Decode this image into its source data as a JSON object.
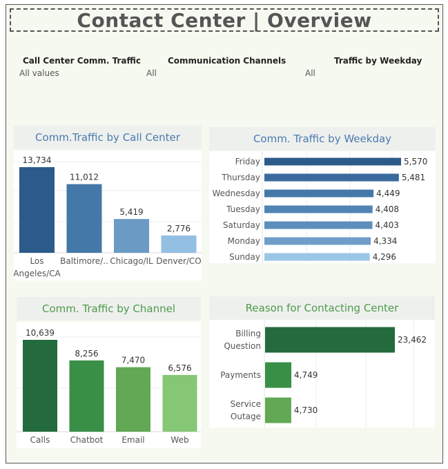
{
  "title": "Contact Center | Overview",
  "filters": [
    {
      "label": "Call Center Comm. Traffic",
      "value": "All values",
      "value2": "All"
    },
    {
      "label": "Communication Channels",
      "value": "All"
    },
    {
      "label": "Traffic by Weekday",
      "value": "All"
    }
  ],
  "colors": {
    "blue_dark": "#2c5a8a",
    "blue_mid": "#4478a9",
    "blue_light": "#6b9ac4",
    "blue_pale": "#93bfe2",
    "green_dark": "#236b3c",
    "green_mid": "#3a8f47",
    "green_light": "#62a855",
    "green_pale": "#86c775",
    "blue_title": "#4a7aad",
    "green_title": "#4e9a48"
  },
  "chart_data": [
    {
      "type": "bar",
      "title": "Comm.Traffic by Call Center",
      "categories": [
        "Los Angeles/CA",
        "Baltimore/..",
        "Chicago/IL",
        "Denver/CO"
      ],
      "category_lines": [
        [
          "Los",
          "Angeles/CA"
        ],
        [
          "Baltimore/.."
        ],
        [
          "Chicago/IL"
        ],
        [
          "Denver/CO"
        ]
      ],
      "values": [
        13734,
        11012,
        5419,
        2776
      ],
      "value_labels": [
        "13,734",
        "11,012",
        "5,419",
        "2,776"
      ],
      "bar_colors": [
        "#2c5a8a",
        "#4478a9",
        "#6b9ac4",
        "#93bfe2"
      ]
    },
    {
      "type": "bar",
      "orientation": "horizontal",
      "title": "Comm. Traffic by Weekday",
      "categories": [
        "Friday",
        "Thursday",
        "Wednesday",
        "Tuesday",
        "Saturday",
        "Monday",
        "Sunday"
      ],
      "values": [
        5570,
        5481,
        4449,
        4408,
        4403,
        4334,
        4296
      ],
      "value_labels": [
        "5,570",
        "5,481",
        "4,449",
        "4,408",
        "4,403",
        "4,334",
        "4,296"
      ],
      "bar_colors": [
        "#2c5a8a",
        "#3a6a9d",
        "#4478a9",
        "#5084b4",
        "#5d8fbc",
        "#6f9dc8",
        "#9cc6e6"
      ]
    },
    {
      "type": "bar",
      "title": "Comm. Traffic by Channel",
      "categories": [
        "Calls",
        "Chatbot",
        "Email",
        "Web"
      ],
      "category_lines": [
        [
          "Calls"
        ],
        [
          "Chatbot"
        ],
        [
          "Email"
        ],
        [
          "Web"
        ]
      ],
      "values": [
        10639,
        8256,
        7470,
        6576
      ],
      "value_labels": [
        "10,639",
        "8,256",
        "7,470",
        "6,576"
      ],
      "bar_colors": [
        "#236b3c",
        "#3a8f47",
        "#62a855",
        "#86c775"
      ]
    },
    {
      "type": "bar",
      "orientation": "horizontal",
      "title": "Reason for Contacting Center",
      "categories": [
        "Billing Question",
        "Payments",
        "Service Outage"
      ],
      "category_lines": [
        [
          "Billing",
          "Question"
        ],
        [
          "Payments"
        ],
        [
          "Service",
          "Outage"
        ]
      ],
      "values": [
        23462,
        4749,
        4730
      ],
      "value_labels": [
        "23,462",
        "4,749",
        "4,730"
      ],
      "bar_colors": [
        "#236b3c",
        "#3a8f47",
        "#62a855"
      ]
    }
  ]
}
